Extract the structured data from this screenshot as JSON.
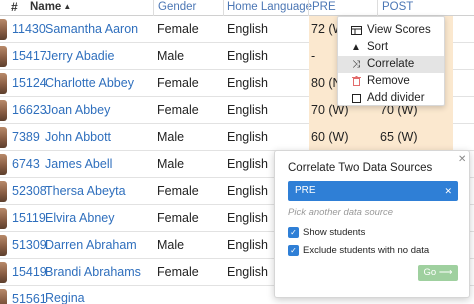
{
  "header": {
    "hash": "#",
    "name": "Name",
    "name_sort_icon": "caret-up-icon",
    "gender": "Gender",
    "language": "Home Language",
    "pre": "PRE",
    "post": "POST"
  },
  "rows": [
    {
      "id": "11430",
      "name": "Samantha Aaron",
      "gender": "Female",
      "language": "English",
      "pre": "72 (W)",
      "post": ""
    },
    {
      "id": "15417",
      "name": "Jerry Abadie",
      "gender": "Male",
      "language": "English",
      "pre": "-",
      "post": ""
    },
    {
      "id": "15124",
      "name": "Charlotte Abbey",
      "gender": "Female",
      "language": "English",
      "pre": "80 (N)",
      "post": ""
    },
    {
      "id": "16623",
      "name": "Joan Abbey",
      "gender": "Female",
      "language": "English",
      "pre": "70 (W)",
      "post": "70 (W)"
    },
    {
      "id": "7389",
      "name": "John Abbott",
      "gender": "Male",
      "language": "English",
      "pre": "60 (W)",
      "post": "65 (W)"
    },
    {
      "id": "6743",
      "name": "James Abell",
      "gender": "Male",
      "language": "English",
      "pre": "",
      "post": ""
    },
    {
      "id": "52308",
      "name": "Thersa Abeyta",
      "gender": "Female",
      "language": "English",
      "pre": "",
      "post": ""
    },
    {
      "id": "15119",
      "name": "Elvira Abney",
      "gender": "Female",
      "language": "English",
      "pre": "",
      "post": ""
    },
    {
      "id": "51309",
      "name": "Darren Abraham",
      "gender": "Male",
      "language": "English",
      "pre": "",
      "post": ""
    },
    {
      "id": "15419",
      "name": "Brandi Abrahams",
      "gender": "Female",
      "language": "English",
      "pre": "",
      "post": ""
    },
    {
      "id": "51561",
      "name": "Regina",
      "gender": "",
      "language": "",
      "pre": "",
      "post": ""
    }
  ],
  "menu": {
    "items": [
      {
        "icon": "columns-icon",
        "label": "View Scores"
      },
      {
        "icon": "sort-up-icon",
        "label": "Sort"
      },
      {
        "icon": "shuffle-icon",
        "label": "Correlate"
      },
      {
        "icon": "trash-icon",
        "label": "Remove"
      },
      {
        "icon": "square-icon",
        "label": "Add divider"
      }
    ],
    "active_index": 2
  },
  "correlate": {
    "title": "Correlate Two Data Sources",
    "selected_source": "PRE",
    "placeholder": "Pick another data source",
    "show_students": "Show students",
    "exclude_label": "Exclude students with no data",
    "go_label": "Go",
    "go_icon": "arrow-right-icon"
  },
  "colors": {
    "link": "#2f6fbd",
    "score_bg": "#fbe8cf",
    "accent": "#2f7fd6",
    "go_button": "#9fd09f"
  }
}
